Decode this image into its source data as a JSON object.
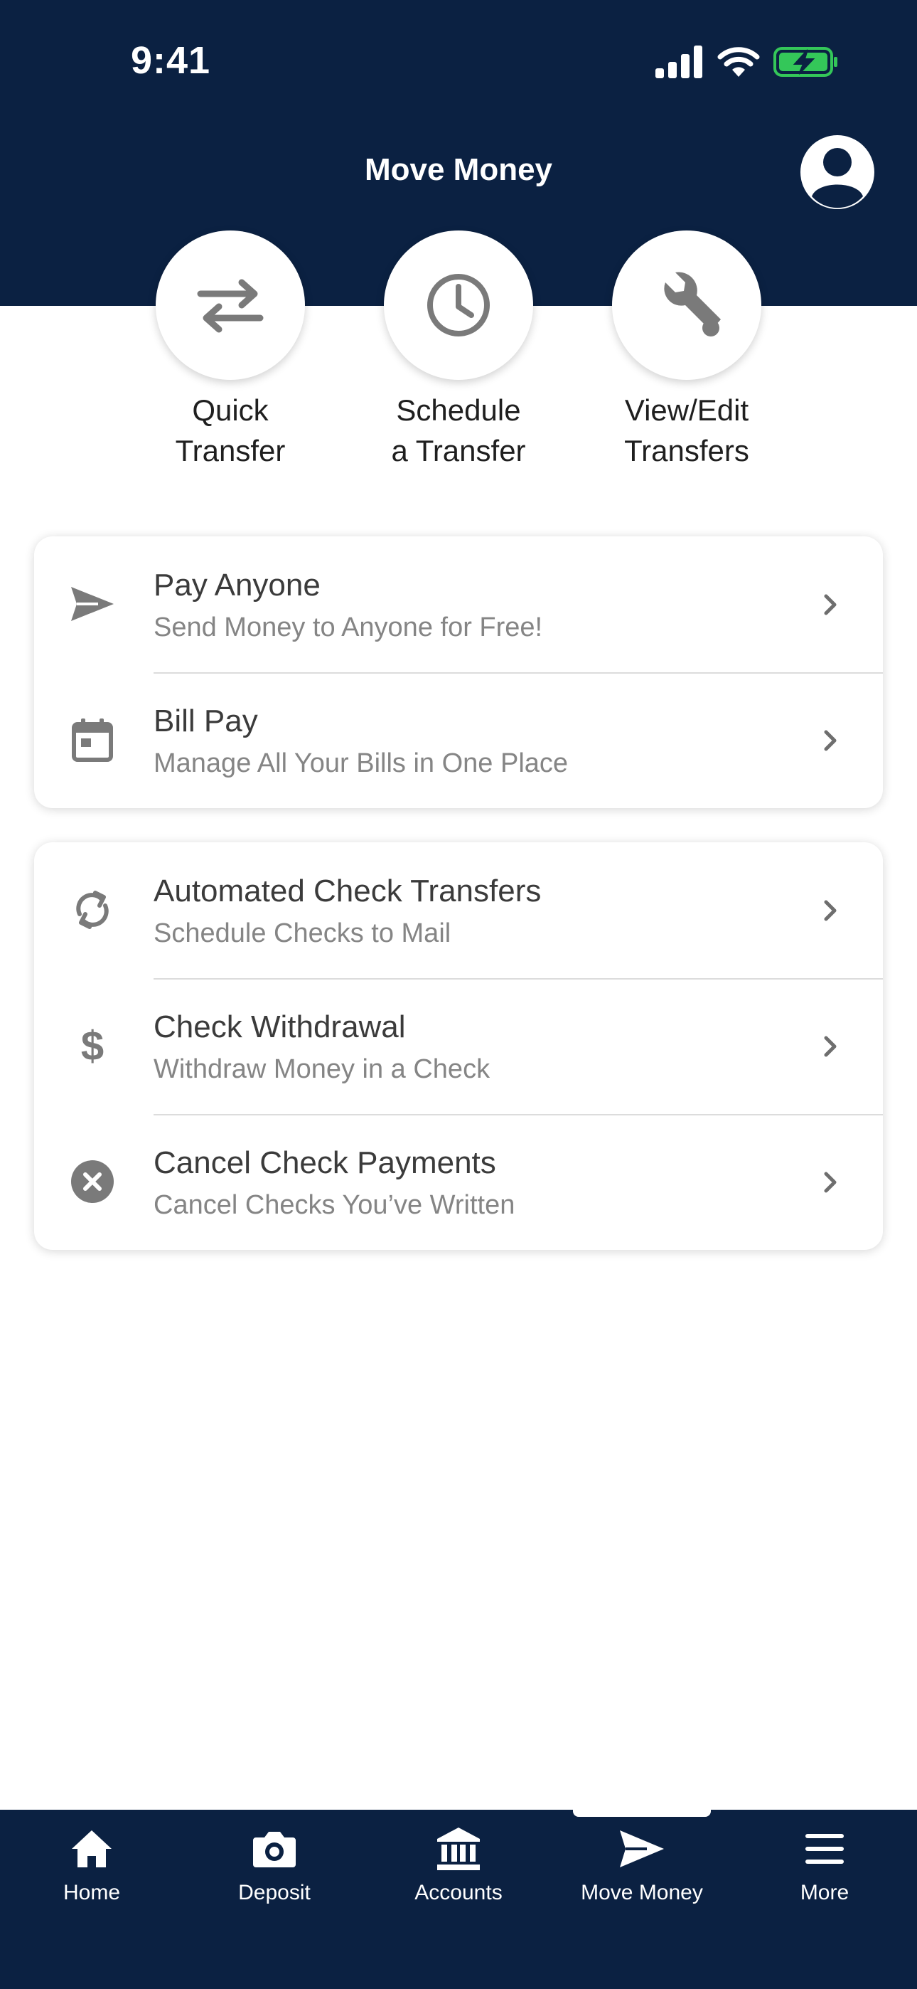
{
  "status_bar": {
    "time": "9:41"
  },
  "header": {
    "title": "Move Money"
  },
  "quick_actions": [
    {
      "label": "Quick\nTransfer",
      "icon": "swap-arrows-icon"
    },
    {
      "label": "Schedule\na Transfer",
      "icon": "clock-icon"
    },
    {
      "label": "View/Edit\nTransfers",
      "icon": "wrench-icon"
    }
  ],
  "card1": [
    {
      "title": "Pay Anyone",
      "subtitle": "Send Money to Anyone for Free!",
      "icon": "paper-plane-icon"
    },
    {
      "title": "Bill Pay",
      "subtitle": "Manage All Your Bills in One Place",
      "icon": "calendar-icon"
    }
  ],
  "card2": [
    {
      "title": "Automated Check Transfers",
      "subtitle": "Schedule Checks to Mail",
      "icon": "refresh-icon"
    },
    {
      "title": "Check Withdrawal",
      "subtitle": "Withdraw Money in a Check",
      "icon": "dollar-icon"
    },
    {
      "title": "Cancel Check Payments",
      "subtitle": "Cancel Checks You’ve Written",
      "icon": "cancel-circle-icon"
    }
  ],
  "tabs": [
    {
      "label": "Home",
      "icon": "home-icon"
    },
    {
      "label": "Deposit",
      "icon": "camera-icon"
    },
    {
      "label": "Accounts",
      "icon": "bank-icon"
    },
    {
      "label": "Move Money",
      "icon": "paper-plane-icon",
      "selected": true
    },
    {
      "label": "More",
      "icon": "menu-icon"
    }
  ],
  "colors": {
    "header_bg": "#0b2142",
    "icon_gray": "#7a7a7a",
    "battery_green": "#34c759"
  }
}
